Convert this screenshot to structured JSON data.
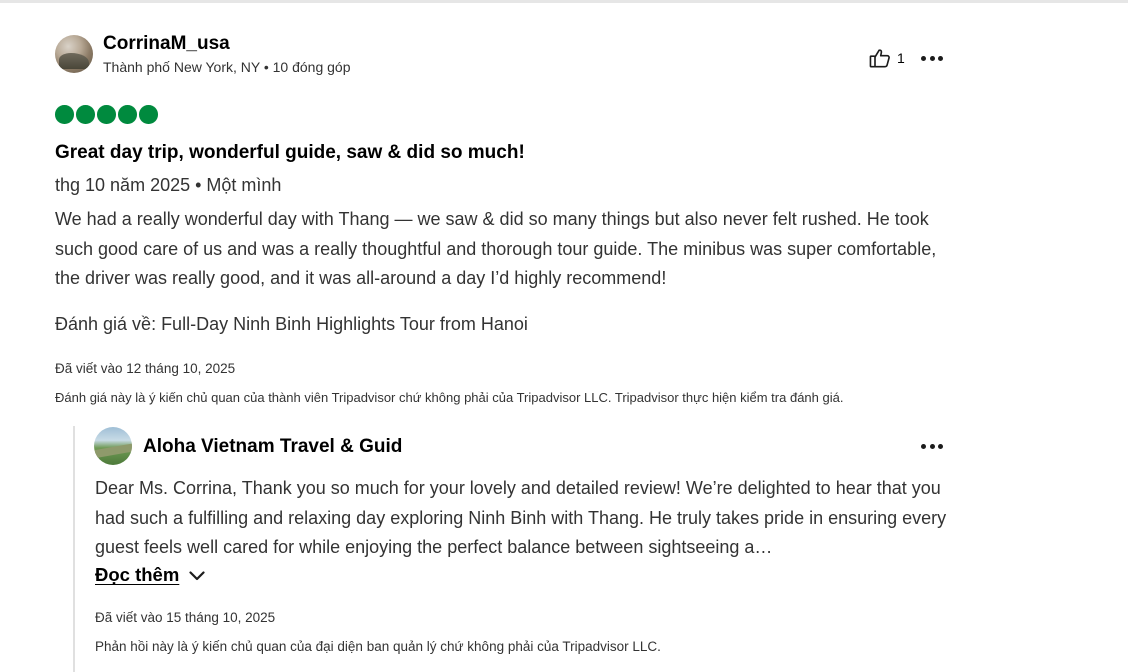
{
  "review": {
    "reviewer_name": "CorrinaM_usa",
    "reviewer_meta": "Thành phố New York, NY • 10 đóng góp",
    "helpful_count": "1",
    "rating": 5,
    "rating_color": "#008a3e",
    "title": "Great day trip, wonderful guide, saw & did so much!",
    "trip_info": "thg 10 năm 2025 • Một mình",
    "body": "We had a really wonderful day with Thang — we saw & did so many things but also never felt rushed. He took such good care of us and was a really thoughtful and thorough tour guide. The minibus was super comfortable, the driver was really good, and it was all-around a day I’d highly recommend!",
    "reviewed_product": "Đánh giá về: Full-Day Ninh Binh Highlights Tour from Hanoi",
    "written_date": "Đã viết vào 12 tháng 10, 2025",
    "disclaimer": "Đánh giá này là ý kiến chủ quan của thành viên Tripadvisor chứ không phải của Tripadvisor LLC. Tripadvisor thực hiện kiểm tra đánh giá."
  },
  "response": {
    "owner_name": "Aloha Vietnam Travel & Guid",
    "body": "Dear Ms. Corrina, Thank you so much for your lovely and detailed review! We’re delighted to hear that you had such a fulfilling and relaxing day exploring Ninh Binh with Thang. He truly takes pride in ensuring every guest feels well cared for while enjoying the perfect balance between sightseeing a…",
    "read_more_label": "Đọc thêm",
    "written_date": "Đã viết vào 15 tháng 10, 2025",
    "disclaimer": "Phản hồi này là ý kiến chủ quan của đại diện ban quản lý chứ không phải của Tripadvisor LLC."
  },
  "icons": {
    "helpful": "thumbs-up-icon",
    "more": "more-options-icon",
    "read_more": "chevron-down-icon"
  }
}
